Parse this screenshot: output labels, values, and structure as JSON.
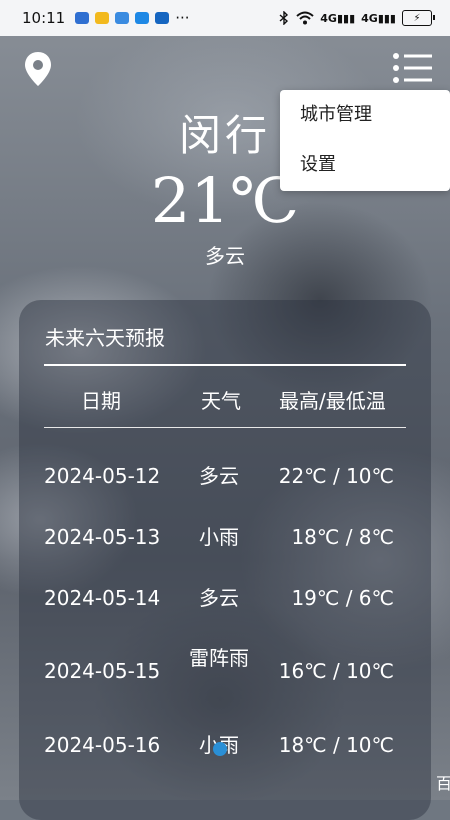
{
  "status": {
    "time": "10:11",
    "dots": "···",
    "signal1": "4G",
    "signal2": "4G"
  },
  "city": "闵行",
  "temperature": "21℃",
  "condition": "多云",
  "menu": {
    "items": [
      "城市管理",
      "设置"
    ]
  },
  "forecast": {
    "title": "未来六天预报",
    "headers": {
      "date": "日期",
      "weather": "天气",
      "temp": "最高/最低温"
    },
    "rows": [
      {
        "date": "2024-05-12",
        "weather": "多云",
        "temp": "22℃ / 10℃"
      },
      {
        "date": "2024-05-13",
        "weather": "小雨",
        "temp": "18℃ / 8℃"
      },
      {
        "date": "2024-05-14",
        "weather": "多云",
        "temp": "19℃ / 6℃"
      },
      {
        "date": "2024-05-15",
        "weather": "雷阵雨",
        "temp": "16℃ / 10℃"
      },
      {
        "date": "2024-05-16",
        "weather": "小雨",
        "temp": "18℃ / 10℃"
      }
    ]
  },
  "corner_text": "百",
  "colors": {
    "accent_dot": "#2a8fd6",
    "panel": "rgba(45,52,64,0.45)"
  }
}
